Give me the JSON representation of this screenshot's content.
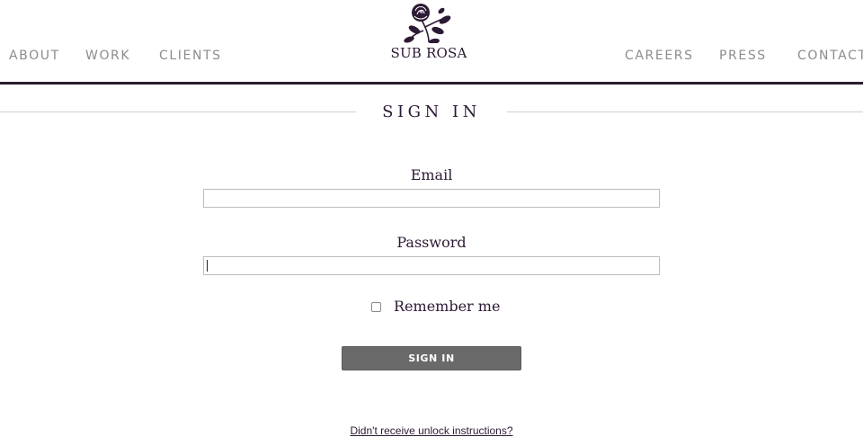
{
  "brand": {
    "name": "SUB ROSA",
    "color": "#2c1a34"
  },
  "nav": {
    "left": [
      "ABOUT",
      "WORK",
      "CLIENTS"
    ],
    "right": [
      "CAREERS",
      "PRESS",
      "CONTACT"
    ]
  },
  "page": {
    "title": "SIGN IN"
  },
  "form": {
    "email_label": "Email",
    "email_value": "",
    "password_label": "Password",
    "password_value": "",
    "remember_label": "Remember me",
    "remember_checked": false,
    "submit_label": "SIGN IN"
  },
  "links": {
    "unlock": "Didn't receive unlock instructions?"
  },
  "icons": {
    "logo": "rose-icon"
  },
  "colors": {
    "button": "#6a6a6a",
    "rule": "#2a1d30",
    "nav_text": "#8c8c8c"
  }
}
